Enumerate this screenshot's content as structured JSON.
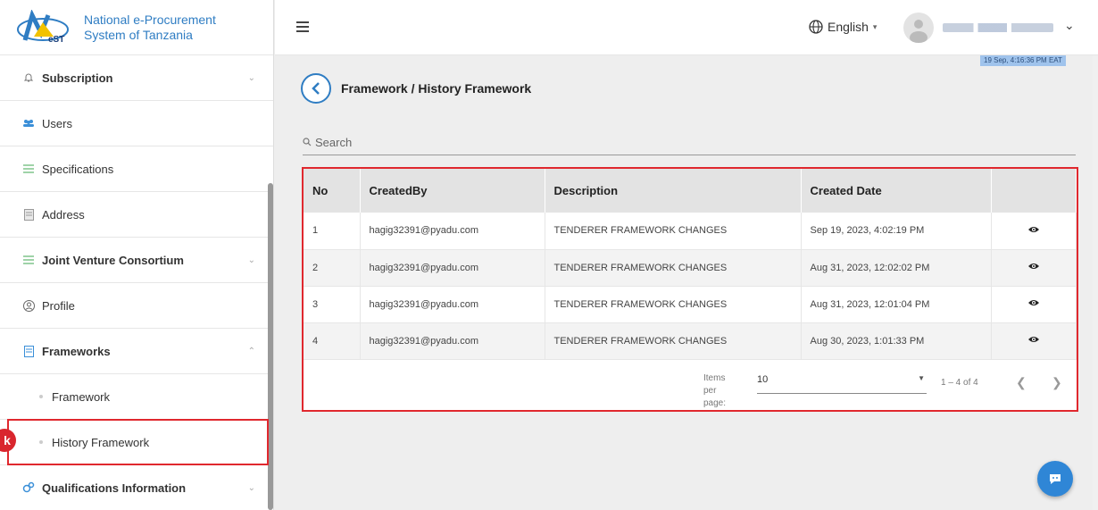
{
  "brand": {
    "line1": "National e-Procurement",
    "line2": "System of Tanzania",
    "logo_text": "NeST"
  },
  "sidebar": {
    "items": [
      {
        "label": "Subscription",
        "icon": "bell-icon",
        "bold": true,
        "chevron": "chevron-down"
      },
      {
        "label": "Users",
        "icon": "users-icon",
        "bold": false
      },
      {
        "label": "Specifications",
        "icon": "list-icon",
        "bold": false
      },
      {
        "label": "Address",
        "icon": "document-icon",
        "bold": false
      },
      {
        "label": "Joint Venture Consortium",
        "icon": "list-icon",
        "bold": true,
        "chevron": "chevron-down"
      },
      {
        "label": "Profile",
        "icon": "person-circle-icon",
        "bold": false
      },
      {
        "label": "Frameworks",
        "icon": "document-icon",
        "bold": true,
        "chevron": "chevron-up"
      },
      {
        "label": "Framework",
        "sub": true
      },
      {
        "label": "History Framework",
        "sub": true,
        "highlighted": true
      },
      {
        "label": "Qualifications Information",
        "icon": "gears-icon",
        "bold": true,
        "chevron": "chevron-down"
      }
    ],
    "annotation_badge": "k"
  },
  "topbar": {
    "language": "English",
    "timestamp": "19 Sep, 4:16:36 PM EAT"
  },
  "main": {
    "breadcrumb": "Framework / History Framework",
    "search_placeholder": "Search",
    "table": {
      "headers": [
        "No",
        "CreatedBy",
        "Description",
        "Created Date",
        ""
      ],
      "rows": [
        [
          "1",
          "hagig32391@pyadu.com",
          "TENDERER FRAMEWORK CHANGES",
          "Sep 19, 2023, 4:02:19 PM"
        ],
        [
          "2",
          "hagig32391@pyadu.com",
          "TENDERER FRAMEWORK CHANGES",
          "Aug 31, 2023, 12:02:02 PM"
        ],
        [
          "3",
          "hagig32391@pyadu.com",
          "TENDERER FRAMEWORK CHANGES",
          "Aug 31, 2023, 12:01:04 PM"
        ],
        [
          "4",
          "hagig32391@pyadu.com",
          "TENDERER FRAMEWORK CHANGES",
          "Aug 30, 2023, 1:01:33 PM"
        ]
      ]
    },
    "pager": {
      "items_per_page_label": "Items per page:",
      "page_size": "10",
      "range": "1 – 4 of 4"
    }
  },
  "colors": {
    "accent": "#2f7dc3",
    "highlight": "#e0282e",
    "header_bg": "#e3e3e3"
  }
}
